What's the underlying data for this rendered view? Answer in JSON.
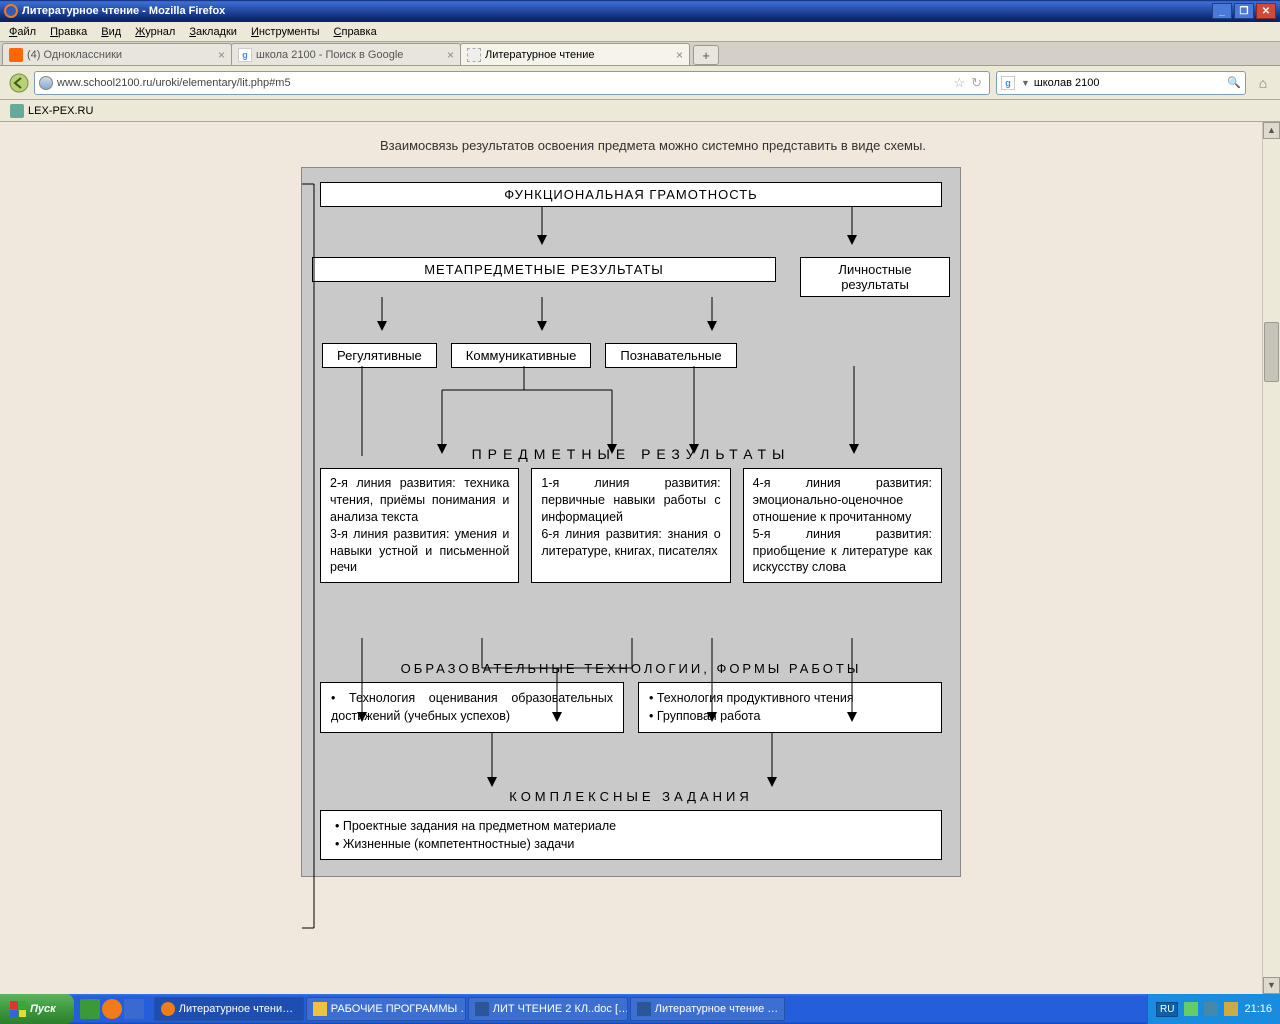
{
  "window": {
    "title": "Литературное чтение - Mozilla Firefox"
  },
  "menu": {
    "file": "Файл",
    "edit": "Правка",
    "view": "Вид",
    "history": "Журнал",
    "bookmarks": "Закладки",
    "tools": "Инструменты",
    "help": "Справка"
  },
  "tabs": [
    {
      "label": "(4) Одноклассники",
      "icon": "#f60"
    },
    {
      "label": "школа 2100 - Поиск в Google",
      "icon": "#4285f4"
    },
    {
      "label": "Литературное чтение",
      "icon": "#ccc",
      "active": true
    }
  ],
  "url": "www.school2100.ru/uroki/elementary/lit.php#m5",
  "search": {
    "query": "школав 2100"
  },
  "bookmark": {
    "label": "LEX-PEX.RU"
  },
  "page": {
    "intro": "Взаимосвязь результатов освоения предмета можно системно представить в виде схемы.",
    "box_top": "ФУНКЦИОНАЛЬНАЯ ГРАМОТНОСТЬ",
    "box_meta": "МЕТАПРЕДМЕТНЫЕ РЕЗУЛЬТАТЫ",
    "box_personal": "Личностные результаты",
    "box_reg": "Регулятивные",
    "box_comm": "Коммуникативные",
    "box_cogn": "Познавательные",
    "subject_title": "ПРЕДМЕТНЫЕ    РЕЗУЛЬТАТЫ",
    "subj1": "2-я линия развития: техника чтения, приёмы понимания и анализа текста\n3-я линия развития: умения и навыки устной и письменной речи",
    "subj2": "1-я линия развития: первичные навыки работы с информацией\n6-я линия развития: знания о литературе, книгах, писателях",
    "subj3": "4-я линия развития: эмоционально-оценочное отношение к прочитанному\n5-я линия развития: приобщение к литературе как искусству слова",
    "edu_title": "ОБРАЗОВАТЕЛЬНЫЕ ТЕХНОЛОГИИ,  ФОРМЫ РАБОТЫ",
    "edu1": "• Технология оценивания образовательных достижений (учебных успехов)",
    "edu2": "• Технология продуктивного чтения\n• Групповая работа",
    "comp_title": "КОМПЛЕКСНЫЕ  ЗАДАНИЯ",
    "comp": "• Проектные задания на предметном материале\n• Жизненные (компетентностные) задачи"
  },
  "taskbar": {
    "start": "Пуск",
    "items": [
      "Литературное чтени…",
      "РАБОЧИЕ ПРОГРАММЫ …",
      "ЛИТ ЧТЕНИЕ 2 КЛ..doc […",
      "Литературное чтение …"
    ],
    "lang": "RU",
    "time": "21:16"
  }
}
